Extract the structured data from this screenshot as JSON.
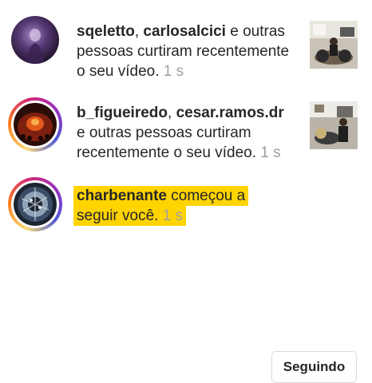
{
  "notifications": [
    {
      "users": [
        "sqeletto",
        "carlosalcici"
      ],
      "separator": ", ",
      "text_line1_rest": " e outras",
      "text_line2": "pessoas curtiram recentemente",
      "text_line3": "o seu vídeo.",
      "time": " 1 s"
    },
    {
      "users": [
        "b_figueiredo",
        "cesar.ramos.dr"
      ],
      "separator": ", ",
      "text_line2": "e outras pessoas curtiram",
      "text_line3": "recentemente o seu vídeo.",
      "time": " 1 s"
    },
    {
      "user": "charbenante",
      "text_line1_rest": " começou a",
      "text_line2": "seguir você.",
      "time": " 1 s",
      "button_label": "Seguindo"
    }
  ],
  "colors": {
    "highlight": "#ffd400",
    "time": "#a0a0a0",
    "text": "#262626"
  }
}
